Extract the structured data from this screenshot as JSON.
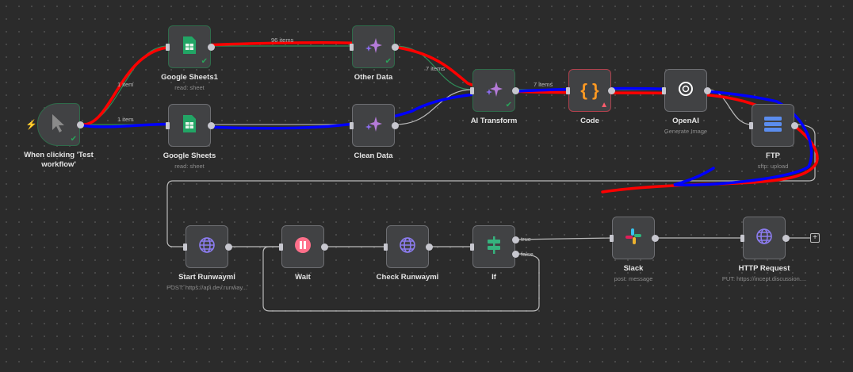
{
  "nodes": [
    {
      "id": "trigger",
      "title": "When clicking 'Test workflow'",
      "subtitle": "",
      "icon": "cursor-icon",
      "status": "success"
    },
    {
      "id": "gs1",
      "title": "Google Sheets1",
      "subtitle": "read: sheet",
      "icon": "google-sheets-icon",
      "status": "success"
    },
    {
      "id": "other",
      "title": "Other Data",
      "subtitle": "",
      "icon": "ai-sparkle-icon",
      "status": "success"
    },
    {
      "id": "gs",
      "title": "Google Sheets",
      "subtitle": "read: sheet",
      "icon": "google-sheets-icon",
      "status": "none"
    },
    {
      "id": "clean",
      "title": "Clean Data",
      "subtitle": "",
      "icon": "ai-sparkle-icon",
      "status": "none"
    },
    {
      "id": "ai",
      "title": "AI Transform",
      "subtitle": "",
      "icon": "ai-sparkle-icon",
      "status": "success"
    },
    {
      "id": "code",
      "title": "Code",
      "subtitle": "",
      "icon": "code-braces-icon",
      "status": "error"
    },
    {
      "id": "openai",
      "title": "OpenAI",
      "subtitle": "Generate Image",
      "icon": "openai-icon",
      "status": "none"
    },
    {
      "id": "ftp",
      "title": "FTP",
      "subtitle": "sftp: upload",
      "icon": "server-icon",
      "status": "none"
    },
    {
      "id": "start",
      "title": "Start Runwayml",
      "subtitle": "POST: https://api.dev.runway...",
      "icon": "globe-icon",
      "status": "none"
    },
    {
      "id": "wait",
      "title": "Wait",
      "subtitle": "",
      "icon": "pause-icon",
      "status": "none"
    },
    {
      "id": "check",
      "title": "Check Runwayml",
      "subtitle": "",
      "icon": "globe-icon",
      "status": "none"
    },
    {
      "id": "if",
      "title": "If",
      "subtitle": "",
      "icon": "signpost-icon",
      "status": "none"
    },
    {
      "id": "slack",
      "title": "Slack",
      "subtitle": "post: message",
      "icon": "slack-icon",
      "status": "none"
    },
    {
      "id": "http",
      "title": "HTTP Request",
      "subtitle": "PUT: https://incept.discussion....",
      "icon": "globe-icon",
      "status": "none"
    }
  ],
  "edge_labels": {
    "t_gs1": "1 item",
    "t_gs": "1 item",
    "gs1_other": "96 items",
    "other_ai": "7 items",
    "ai_code": "7 items",
    "if_true": "true",
    "if_false": "false"
  },
  "colors": {
    "success": "#29a35a",
    "error": "#ff5c6c",
    "annotation_red": "#ff0000",
    "annotation_blue": "#0000ff"
  }
}
